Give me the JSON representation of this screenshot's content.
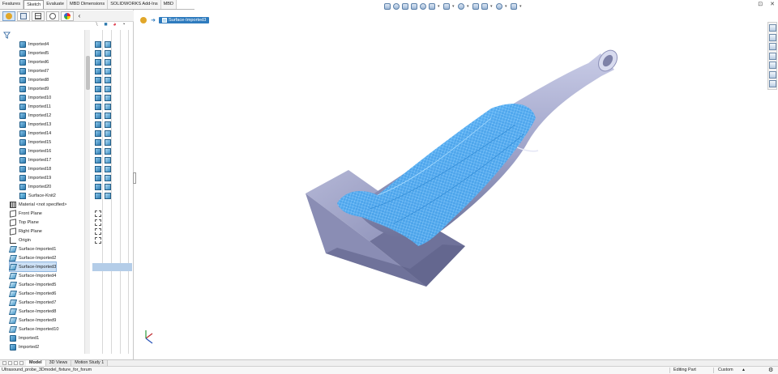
{
  "command_tabs": [
    "Features",
    "Sketch",
    "Evaluate",
    "MBD Dimensions",
    "SOLIDWORKS Add-Ins",
    "MBD"
  ],
  "active_command_tab": "Sketch",
  "view_toolbar_icons": [
    "zoom-to-fit-icon",
    "zoom-to-area-icon",
    "previous-view-icon",
    "section-view-icon",
    "dynamic-annotation-icon",
    "view-orientation-icon",
    "display-style-icon",
    "hide-show-items-icon",
    "edit-appearance-icon",
    "apply-scene-icon",
    "view-settings-icon",
    "display-icon"
  ],
  "window_controls": [
    "⊡",
    "✕",
    "−",
    "⊡",
    "✕"
  ],
  "feature_tree": {
    "filter_icon": "funnel-icon",
    "items": [
      {
        "label": "Imported4",
        "icon": "imported-body-icon",
        "indent": 2
      },
      {
        "label": "Imported5",
        "icon": "imported-body-icon",
        "indent": 2
      },
      {
        "label": "Imported6",
        "icon": "imported-body-icon",
        "indent": 2
      },
      {
        "label": "Imported7",
        "icon": "imported-body-icon",
        "indent": 2
      },
      {
        "label": "Imported8",
        "icon": "imported-body-icon",
        "indent": 2
      },
      {
        "label": "Imported9",
        "icon": "imported-body-icon",
        "indent": 2
      },
      {
        "label": "Imported10",
        "icon": "imported-body-icon",
        "indent": 2
      },
      {
        "label": "Imported11",
        "icon": "imported-body-icon",
        "indent": 2
      },
      {
        "label": "Imported12",
        "icon": "imported-body-icon",
        "indent": 2
      },
      {
        "label": "Imported13",
        "icon": "imported-body-icon",
        "indent": 2
      },
      {
        "label": "Imported14",
        "icon": "imported-body-icon",
        "indent": 2
      },
      {
        "label": "Imported15",
        "icon": "imported-body-icon",
        "indent": 2
      },
      {
        "label": "Imported16",
        "icon": "imported-body-icon",
        "indent": 2
      },
      {
        "label": "Imported17",
        "icon": "imported-body-icon",
        "indent": 2
      },
      {
        "label": "Imported18",
        "icon": "imported-body-icon",
        "indent": 2
      },
      {
        "label": "Imported19",
        "icon": "imported-body-icon",
        "indent": 2
      },
      {
        "label": "Imported20",
        "icon": "imported-body-icon",
        "indent": 2
      },
      {
        "label": "Surface-Knit2",
        "icon": "surface-knit-icon",
        "indent": 2
      },
      {
        "label": "Material <not specified>",
        "icon": "material-icon",
        "indent": 1
      },
      {
        "label": "Front Plane",
        "icon": "plane-icon",
        "indent": 1
      },
      {
        "label": "Top Plane",
        "icon": "plane-icon",
        "indent": 1
      },
      {
        "label": "Right Plane",
        "icon": "plane-icon",
        "indent": 1
      },
      {
        "label": "Origin",
        "icon": "origin-icon",
        "indent": 1
      },
      {
        "label": "Surface-Imported1",
        "icon": "surface-imported-icon",
        "indent": 1
      },
      {
        "label": "Surface-Imported2",
        "icon": "surface-imported-icon",
        "indent": 1
      },
      {
        "label": "Surface-Imported3",
        "icon": "surface-imported-icon",
        "indent": 1,
        "selected": true
      },
      {
        "label": "Surface-Imported4",
        "icon": "surface-imported-icon",
        "indent": 1
      },
      {
        "label": "Surface-Imported5",
        "icon": "surface-imported-icon",
        "indent": 1
      },
      {
        "label": "Surface-Imported6",
        "icon": "surface-imported-icon",
        "indent": 1
      },
      {
        "label": "Surface-Imported7",
        "icon": "surface-imported-icon",
        "indent": 1
      },
      {
        "label": "Surface-Imported8",
        "icon": "surface-imported-icon",
        "indent": 1
      },
      {
        "label": "Surface-Imported9",
        "icon": "surface-imported-icon",
        "indent": 1
      },
      {
        "label": "Surface-Imported10",
        "icon": "surface-imported-icon",
        "indent": 1
      },
      {
        "label": "Imported1",
        "icon": "imported-solid-icon",
        "indent": 1
      },
      {
        "label": "Imported2",
        "icon": "imported-solid-icon",
        "indent": 1
      }
    ]
  },
  "breadcrumb": {
    "label": "Surface-Imported3"
  },
  "bottom_tabs": [
    "Model",
    "3D Views",
    "Motion Study 1"
  ],
  "active_bottom_tab": "Model",
  "status_bar": {
    "filename": "Ultrasound_probe_3Dmodel_fixture_for_forum",
    "mode": "Editing Part",
    "units": "Custom",
    "units_caret": "▲"
  },
  "colors": {
    "accent": "#2e7bbe",
    "surface_blue": "#3f9fea",
    "model_gray": "#9fa3c9",
    "block_gray": "#a8abc9"
  },
  "task_pane_icons": [
    "home-icon",
    "resources-icon",
    "design-library-icon",
    "file-explorer-icon",
    "appearances-icon",
    "custom-properties-icon",
    "solidworks-forum-icon"
  ]
}
